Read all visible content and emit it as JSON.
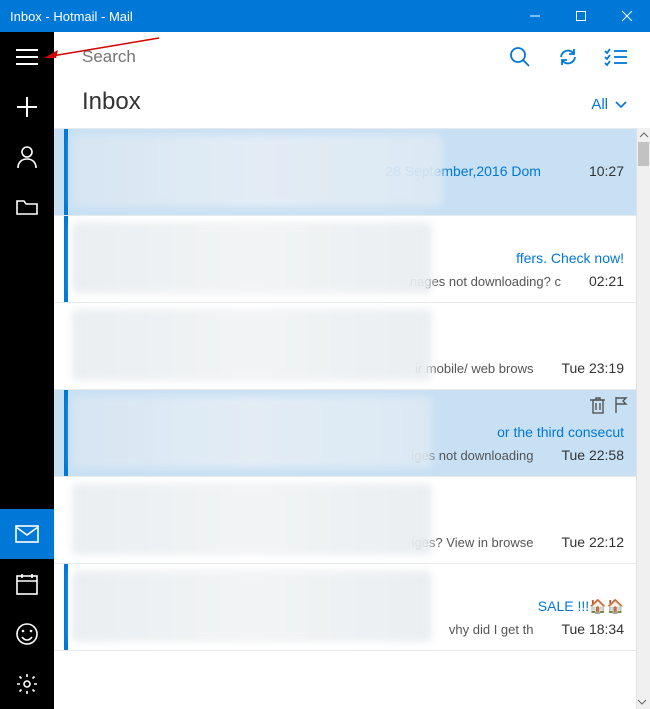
{
  "window": {
    "title": "Inbox - Hotmail - Mail"
  },
  "search": {
    "placeholder": "Search"
  },
  "header": {
    "title": "Inbox",
    "filter": "All"
  },
  "messages": [
    {
      "selected": true,
      "unread": true,
      "subject_fragment": "28 September,2016 Dom",
      "preview_fragment": "",
      "time": "10:27",
      "blur_width": 370
    },
    {
      "selected": false,
      "unread": true,
      "subject_fragment": "ffers. Check now!",
      "preview_fragment": "nages not downloading? c",
      "time": "02:21",
      "blur_width": 360
    },
    {
      "selected": false,
      "unread": false,
      "subject_fragment": "",
      "preview_fragment": "ir mobile/ web brows",
      "time": "Tue 23:19",
      "blur_width": 360
    },
    {
      "selected": true,
      "unread": true,
      "subject_fragment": "or the third consecut",
      "preview_fragment": "iges not downloading",
      "time": "Tue 22:58",
      "show_actions": true,
      "blur_width": 360
    },
    {
      "selected": false,
      "unread": false,
      "subject_fragment": "",
      "preview_fragment": "iges? View in browse",
      "time": "Tue 22:12",
      "blur_width": 360
    },
    {
      "selected": false,
      "unread": true,
      "subject_fragment": "SALE !!!🏠🏠",
      "preview_fragment": "vhy did I get th",
      "time": "Tue 18:34",
      "blur_width": 360
    }
  ]
}
